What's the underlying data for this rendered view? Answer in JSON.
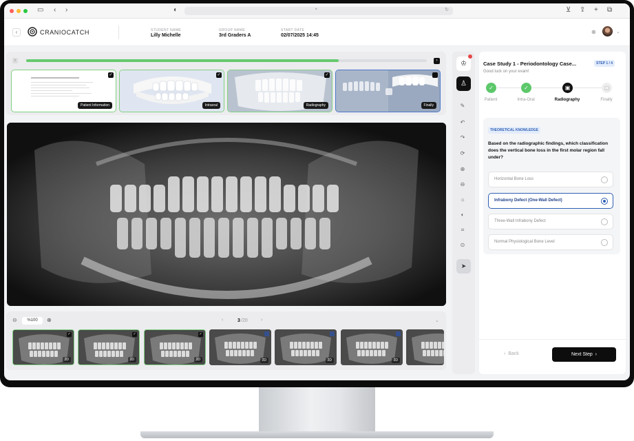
{
  "header": {
    "brand": "CRANIOCATCH",
    "student_name_label": "STUDENT NAME",
    "student_name": "Lilly Michelle",
    "group_name_label": "GROUP NAME",
    "group_name": "3rd Graders A",
    "start_date_label": "START DATE",
    "start_date": "02/07/2025 14:45"
  },
  "progress": {
    "fraction": 0.78
  },
  "top_thumbs": [
    {
      "label": "Patient Information"
    },
    {
      "label": "Intraoral"
    },
    {
      "label": "Radiography"
    },
    {
      "label": "Finally"
    }
  ],
  "viewer": {
    "zoom": "%100",
    "page_current": "3",
    "page_total": "/20"
  },
  "bottom_thumbs": [
    {
      "label": "2D"
    },
    {
      "label": "2D"
    },
    {
      "label": "2D"
    },
    {
      "label": "2D"
    },
    {
      "label": "2D"
    },
    {
      "label": "2D"
    },
    {
      "label": ""
    }
  ],
  "case": {
    "title": "Case Study 1 - Periodontology Case...",
    "subtitle": "Good luck on your exam!",
    "step_badge": "STEP 1 / 4"
  },
  "steps": [
    {
      "label": "Patient",
      "state": "done"
    },
    {
      "label": "Intra-Oral",
      "state": "done"
    },
    {
      "label": "Radiography",
      "state": "current"
    },
    {
      "label": "Finally",
      "state": "pending"
    }
  ],
  "question": {
    "badge": "THEORETICAL KNOWLEDGE",
    "text": "Based on the radiographic findings, which classification does the vertical bone loss in the first molar region fall under?",
    "options": [
      {
        "label": "Horizontal Bone Loss"
      },
      {
        "label": "Infrabony Defect (One-Wall Defect)"
      },
      {
        "label": "Three-Wall Infrabony Defect"
      },
      {
        "label": "Normal Physiological Bone Level"
      }
    ],
    "selected_index": 1
  },
  "nav": {
    "back_label": "Back",
    "next_label": "Next Step"
  },
  "colors": {
    "accent_blue": "#2f5fb3",
    "success_green": "#5cc86a",
    "progress_green": "#66c96f"
  }
}
